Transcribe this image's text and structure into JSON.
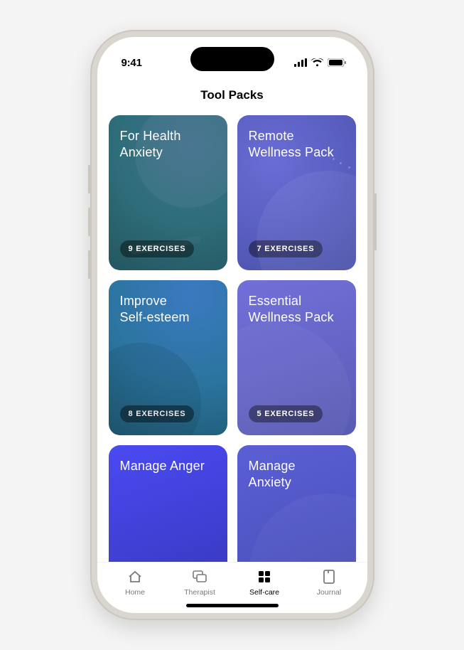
{
  "status": {
    "time": "9:41"
  },
  "header": {
    "title": "Tool Packs"
  },
  "cards": [
    {
      "title": "For Health\nAnxiety",
      "badge": "9 EXERCISES"
    },
    {
      "title": "Remote\nWellness Pack",
      "badge": "7 EXERCISES"
    },
    {
      "title": "Improve\nSelf-esteem",
      "badge": "8 EXERCISES"
    },
    {
      "title": "Essential\nWellness Pack",
      "badge": "5 EXERCISES"
    },
    {
      "title": "Manage Anger",
      "badge": ""
    },
    {
      "title": "Manage\nAnxiety",
      "badge": ""
    }
  ],
  "tabs": [
    {
      "label": "Home"
    },
    {
      "label": "Therapist"
    },
    {
      "label": "Self-care"
    },
    {
      "label": "Journal"
    }
  ],
  "active_tab_index": 2
}
